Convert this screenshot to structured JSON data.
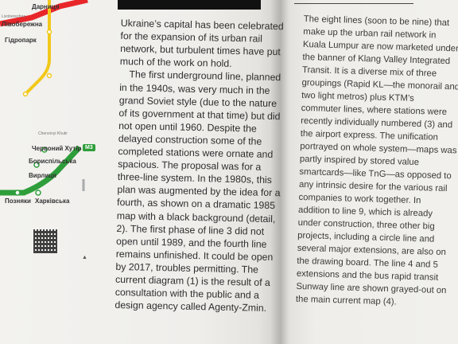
{
  "left_page": {
    "map_stations": {
      "darnytsia": "Дарниця",
      "livoberezhna_latin": "Livoberezhna",
      "livoberezhna": "Лівобережна",
      "hidropark": "Гідропарк",
      "chervonyi_khutir_latin": "Chervonyi Khutir",
      "chervonyi_khutir": "Червоний Хутір",
      "boryspilska": "Бориспільська",
      "vyrlytsia": "Вирлиця",
      "pozniaky": "Позняки",
      "kharkivska": "Харківська"
    },
    "line_badge": "M3",
    "line_color": "#2e9e3a",
    "red_line_color": "#e8262a",
    "yellow_line_color": "#f2c81a"
  },
  "middle_column_lines": [
    "Ukraine’s capital has been celebrated",
    "for the expansion of its urban rail",
    "network, but turbulent times have put",
    "much of the work on hold.",
    "The first underground line, planned",
    "in the 1940s, was very much in the",
    "grand Soviet style (due to the nature",
    "of its government at that time) but did",
    "not open until 1960. Despite the",
    "delayed construction some of the",
    "completed stations were ornate and",
    "spacious. The proposal was for a",
    "three-line system. In the 1980s, this",
    "plan was augmented by the idea for a",
    "fourth, as shown on a dramatic 1985",
    "map with a black background (detail,",
    "2). The first phase of line 3 did not",
    "open until 1989, and the fourth line",
    "remains unfinished. It could be open",
    "by 2017, troubles permitting. The",
    "current diagram (1) is the result of a",
    "consultation with the public and a",
    "design agency called Agenty-Zmin."
  ],
  "right_column_lines": [
    "The eight lines (soon to be nine) that",
    "make up the urban rail network in",
    "Kuala Lumpur are now marketed under",
    "the banner of Klang Valley Integrated",
    "Transit. It is a diverse mix of three",
    "groupings (Rapid KL—the monorail and",
    "two light metros) plus KTM’s",
    "commuter lines, where stations were",
    "recently individually numbered (3) and",
    "the airport express. The unification",
    "portrayed on whole system—maps was",
    "partly inspired by stored value",
    "smartcards—like TnG—as opposed to",
    "any intrinsic desire for the various rail",
    "companies to work together. In",
    "addition to line 9, which is already",
    "under construction, three other big",
    "projects, including a circle line and",
    "several major extensions, are also on",
    "the drawing board. The line 4 and 5",
    "extensions and the bus rapid transit",
    "Sunway line are shown grayed-out on",
    "the main current map (4)."
  ]
}
